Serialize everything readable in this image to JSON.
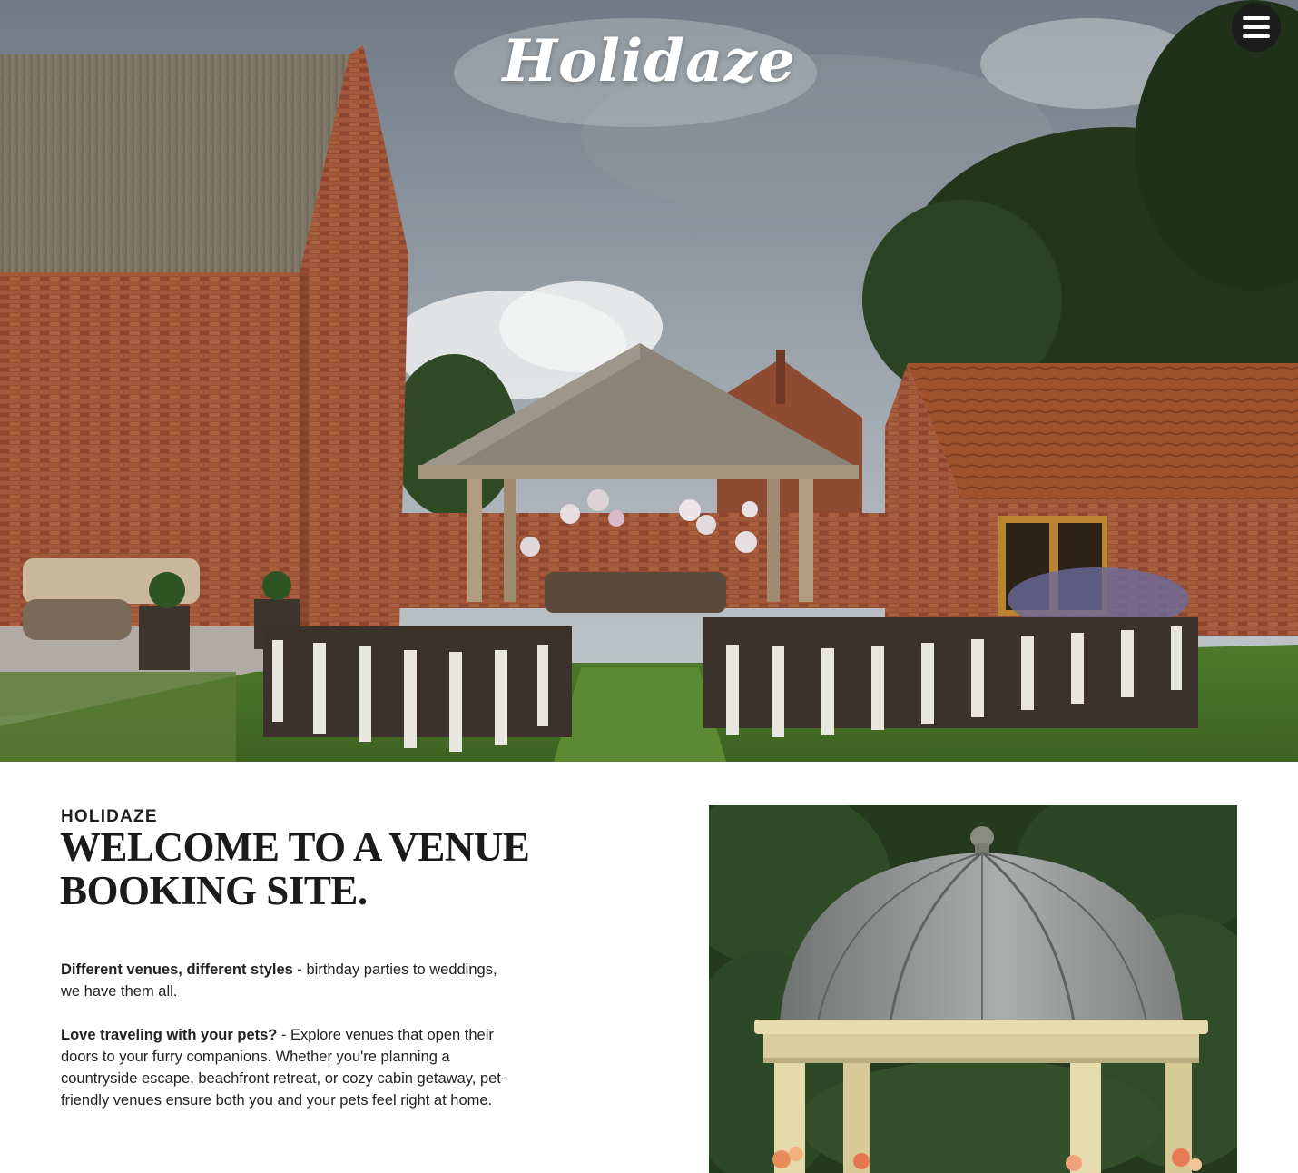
{
  "header": {
    "logo_text": "Holidaze",
    "menu_icon": "hamburger-menu-icon"
  },
  "hero": {
    "image_description_icon": "venue-photo"
  },
  "intro": {
    "eyebrow": "HOLIDAZE",
    "headline": "WELCOME TO A VENUE BOOKING SITE.",
    "paragraph1_bold": "Different venues, different styles",
    "paragraph1_rest": " - birthday parties to weddings, we have them all.",
    "paragraph2_bold": "Love traveling with your pets?",
    "paragraph2_rest": " - Explore venues that open their doors to your furry companions. Whether you're planning a countryside escape, beachfront retreat, or cozy cabin getaway, pet-friendly venues ensure both you and your pets feel right at home."
  },
  "colors": {
    "menu_button_bg": "#1c1c1c",
    "text": "#1f1f1f",
    "page_bg": "#ffffff"
  }
}
